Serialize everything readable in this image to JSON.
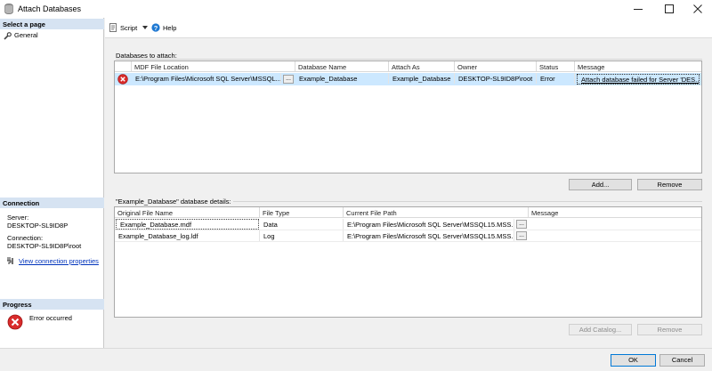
{
  "window": {
    "title": "Attach Databases",
    "minimize_icon": "minimize-icon",
    "maximize_icon": "maximize-icon",
    "close_icon": "close-icon"
  },
  "left_pane": {
    "select_page_header": "Select a page",
    "pages": [
      {
        "label": "General",
        "icon": "wrench-icon"
      }
    ],
    "connection_header": "Connection",
    "server_label": "Server:",
    "server_value": "DESKTOP-SL9ID8P",
    "connection_label": "Connection:",
    "connection_value": "DESKTOP-SL9ID8P\\root",
    "view_connection_properties": "View connection properties",
    "progress_header": "Progress",
    "progress_status": "Error occurred"
  },
  "toolbar": {
    "script_label": "Script",
    "help_label": "Help"
  },
  "attach": {
    "caption": "Databases to attach:",
    "columns": [
      "MDF File Location",
      "Database Name",
      "Attach As",
      "Owner",
      "Status",
      "Message"
    ],
    "rows": [
      {
        "mdf_location": "E:\\Program Files\\Microsoft SQL Server\\MSSQL...",
        "database_name": "Example_Database",
        "attach_as": "Example_Database",
        "owner": "DESKTOP-SL9ID8P\\root",
        "status": "Error",
        "message": "Attach database failed for Server 'DES...",
        "ellipsis": "..."
      }
    ],
    "add_button": "Add...",
    "remove_button": "Remove"
  },
  "details": {
    "caption": "\"Example_Database\" database details:",
    "columns": [
      "Original File Name",
      "File Type",
      "Current File Path",
      "Message"
    ],
    "rows": [
      {
        "file_name": "Example_Database.mdf",
        "file_type": "Data",
        "path": "E:\\Program Files\\Microsoft SQL Server\\MSSQL15.MSS...",
        "message": "",
        "ellipsis": "..."
      },
      {
        "file_name": "Example_Database_log.ldf",
        "file_type": "Log",
        "path": "E:\\Program Files\\Microsoft SQL Server\\MSSQL15.MSS...",
        "message": "",
        "ellipsis": "..."
      }
    ],
    "add_catalog_button": "Add Catalog...",
    "remove_button": "Remove"
  },
  "footer": {
    "ok_button": "OK",
    "cancel_button": "Cancel"
  }
}
